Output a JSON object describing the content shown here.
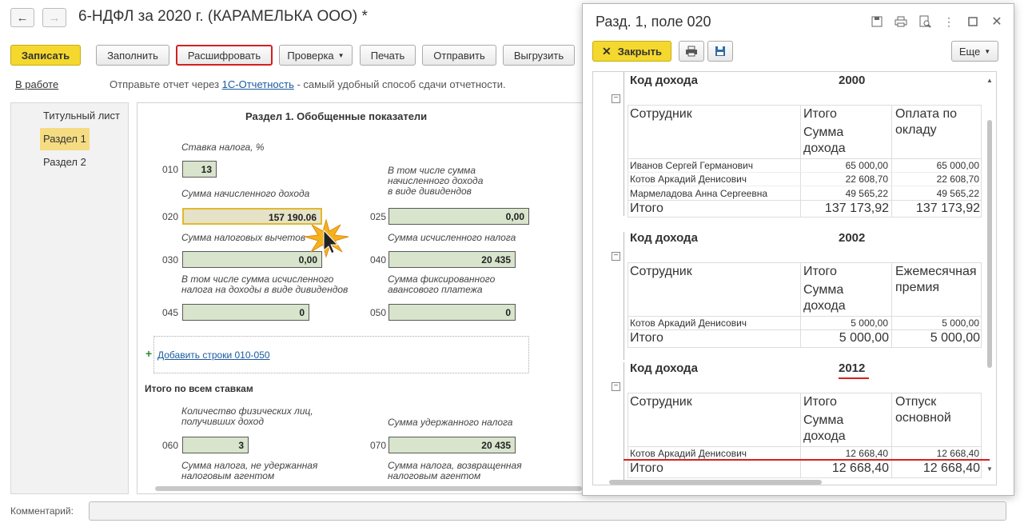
{
  "window": {
    "title": "6-НДФЛ за 2020 г. (КАРАМЕЛЬКА ООО) *",
    "back_icon": "←",
    "forward_icon": "→"
  },
  "toolbar": {
    "save": "Записать",
    "fill": "Заполнить",
    "decode": "Расшифровать",
    "check": "Проверка",
    "print": "Печать",
    "send": "Отправить",
    "export": "Выгрузить"
  },
  "status": {
    "state": "В работе",
    "hint_before": "Отправьте отчет через ",
    "hint_link": "1С-Отчетность",
    "hint_after": " - самый удобный способ сдачи отчетности."
  },
  "sidebar": {
    "items": [
      {
        "label": "Титульный лист"
      },
      {
        "label": "Раздел 1"
      },
      {
        "label": "Раздел 2"
      }
    ]
  },
  "section": {
    "title": "Раздел 1. Обобщенные показатели",
    "rate_label": "Ставка налога, %",
    "code_010": "010",
    "value_010": "13",
    "income_label": "Сумма начисленного дохода",
    "dividends_label": "В том числе сумма\nначисленного дохода\nв виде дивидендов",
    "code_020": "020",
    "value_020": "157 190.06",
    "code_025": "025",
    "value_025": "0,00",
    "deductions_label": "Сумма налоговых вычетов",
    "calc_tax_label": "Сумма исчисленного налога",
    "code_030": "030",
    "value_030": "0,00",
    "code_040": "040",
    "value_040": "20 435",
    "div_tax_label": "В том числе сумма исчисленного\nналога на доходы в виде дивидендов",
    "fixed_advance_label": "Сумма фиксированного\nавансового платежа",
    "code_045": "045",
    "value_045": "0",
    "code_050": "050",
    "value_050": "0",
    "add_rows": "Добавить строки 010-050",
    "totals_title": "Итого по всем ставкам",
    "persons_label": "Количество физических лиц,\nполучивших доход",
    "withheld_label": "Сумма удержанного налога",
    "code_060": "060",
    "value_060": "3",
    "code_070": "070",
    "value_070": "20 435",
    "not_withheld_label": "Сумма налога, не удержанная\nналоговым агентом",
    "returned_label": "Сумма налога, возвращенная\nналоговым агентом"
  },
  "popup": {
    "title": "Разд. 1, поле 020",
    "close": "Закрыть",
    "more": "Еще",
    "groups": [
      {
        "code_label": "Код дохода",
        "code": "2000",
        "col_employee": "Сотрудник",
        "col_total": "Итого",
        "col_sum": "Сумма дохода",
        "col_type": "Оплата по окладу",
        "rows": [
          {
            "name": "Иванов Сергей Германович",
            "total": "65 000,00",
            "type_value": "65 000,00"
          },
          {
            "name": "Котов Аркадий Денисович",
            "total": "22 608,70",
            "type_value": "22 608,70"
          },
          {
            "name": "Мармеладова Анна Сергеевна",
            "total": "49 565,22",
            "type_value": "49 565,22"
          }
        ],
        "footer_label": "Итого",
        "footer_total": "137 173,92",
        "footer_type": "137 173,92"
      },
      {
        "code_label": "Код дохода",
        "code": "2002",
        "col_employee": "Сотрудник",
        "col_total": "Итого",
        "col_sum": "Сумма дохода",
        "col_type": "Ежемесячная премия",
        "rows": [
          {
            "name": "Котов Аркадий Денисович",
            "total": "5 000,00",
            "type_value": "5 000,00"
          }
        ],
        "footer_label": "Итого",
        "footer_total": "5 000,00",
        "footer_type": "5 000,00"
      },
      {
        "code_label": "Код дохода",
        "code": "2012",
        "col_employee": "Сотрудник",
        "col_total": "Итого",
        "col_sum": "Сумма дохода",
        "col_type": "Отпуск основной",
        "rows": [
          {
            "name": "Котов Аркадий Денисович",
            "total": "12 668,40",
            "type_value": "12 668,40"
          }
        ],
        "footer_label": "Итого",
        "footer_total": "12 668,40",
        "footer_type": "12 668,40"
      }
    ]
  },
  "comment": {
    "label": "Комментарий:",
    "value": ""
  },
  "colors": {
    "accent_yellow": "#f4d82e",
    "highlight_red": "#d42020",
    "field_green": "#d8e4cc"
  }
}
